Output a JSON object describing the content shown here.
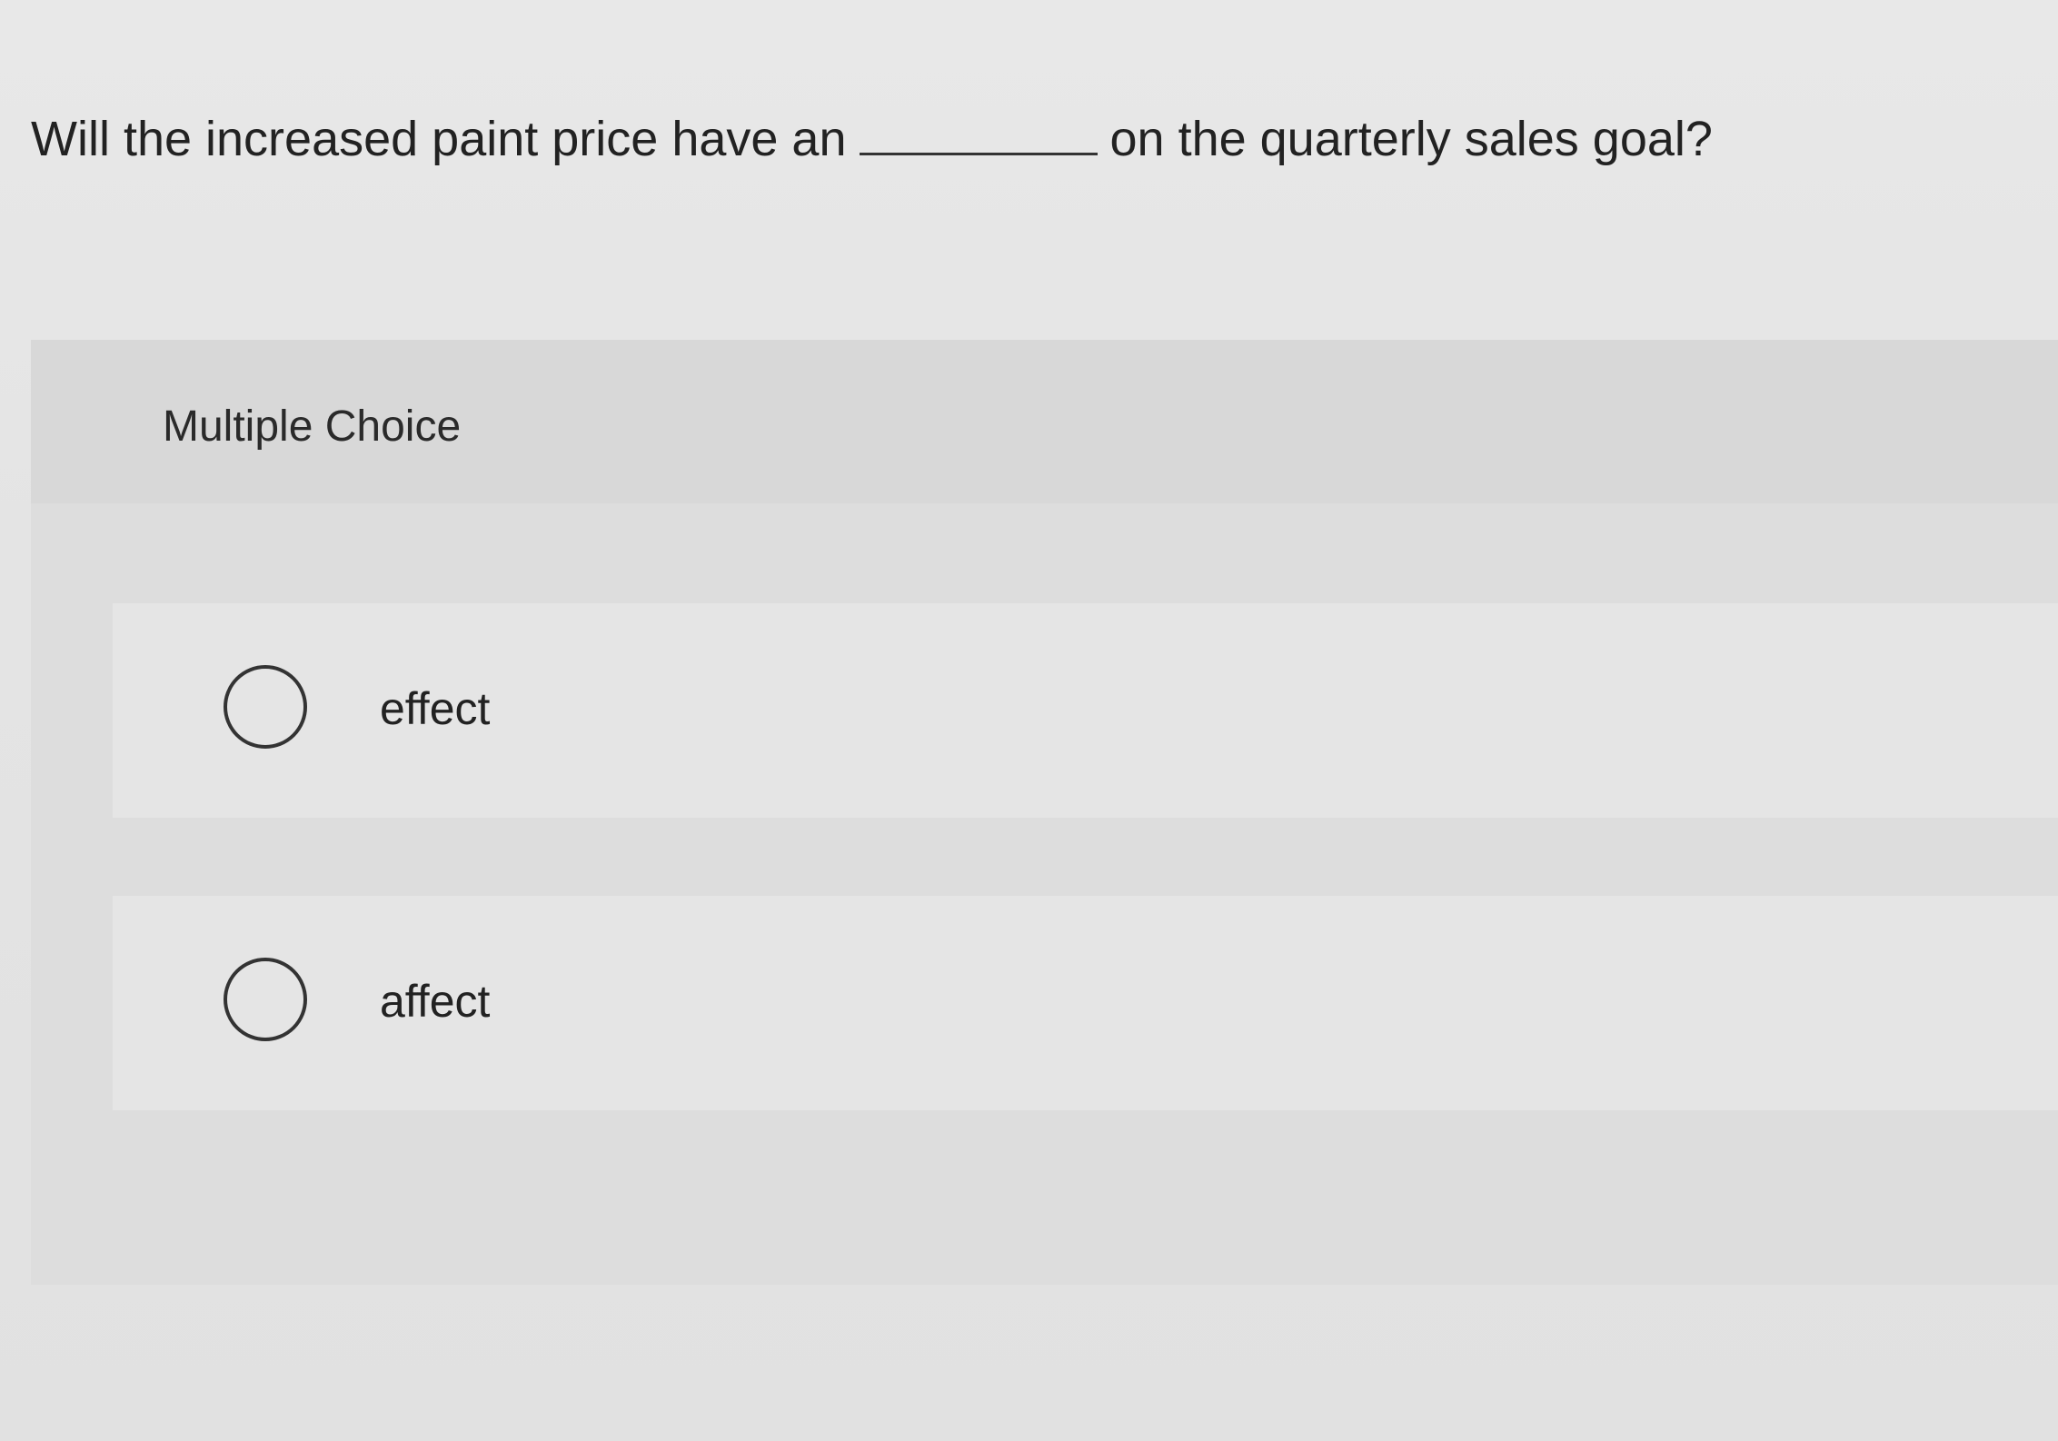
{
  "question": {
    "before_blank": "Will the increased paint price have an",
    "after_blank": "on the quarterly sales goal?"
  },
  "multiple_choice": {
    "label": "Multiple Choice",
    "options": [
      {
        "label": "effect"
      },
      {
        "label": "affect"
      }
    ]
  }
}
